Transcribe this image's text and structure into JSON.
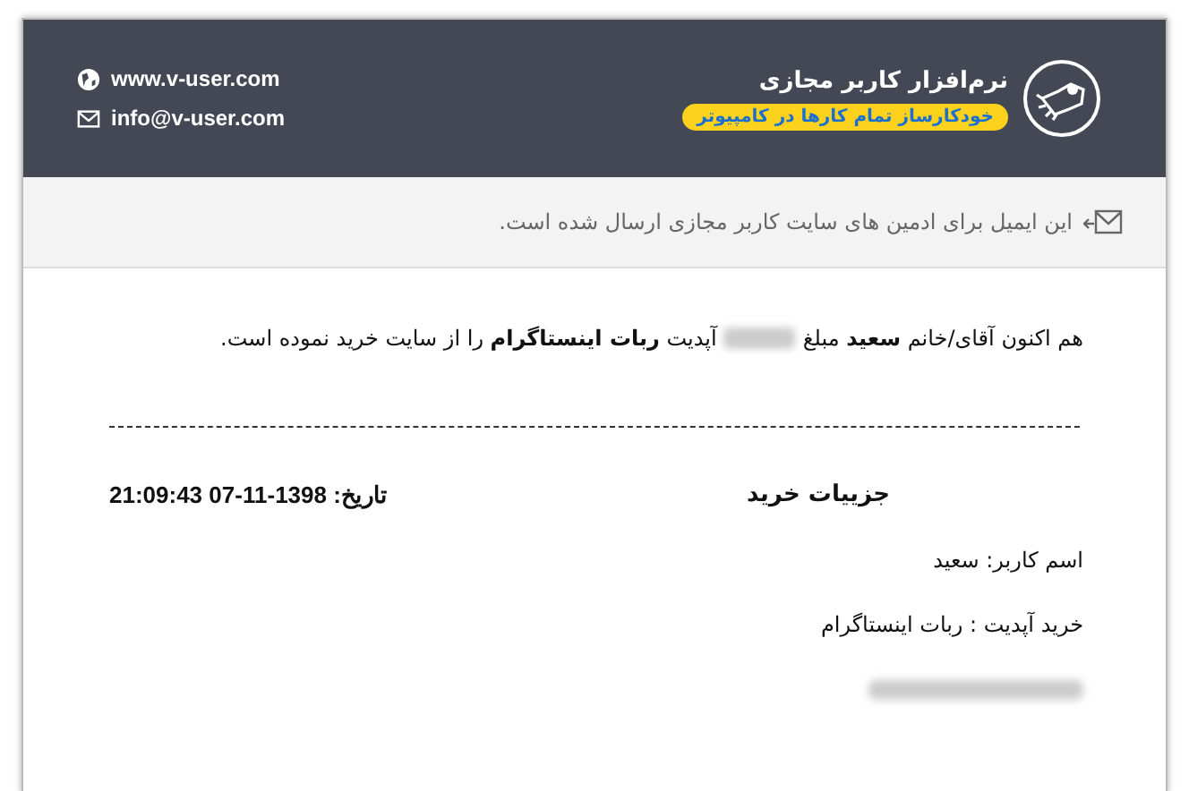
{
  "header": {
    "brand_title": "نرم‌افزار کاربر مجازی",
    "brand_tagline": "خودکارساز تمام کارها در کامپیوتر",
    "contacts": [
      {
        "kind": "web",
        "text": "www.v-user.com"
      },
      {
        "kind": "mail",
        "text": "info@v-user.com"
      }
    ]
  },
  "notice": "این ایمیل برای ادمین های سایت کاربر مجازی ارسال شده است.",
  "message": {
    "before_amount": "هم اکنون آقای/خانم **سعید** مبلغ",
    "after_amount": "آپدیت **ربات اینستاگرام** را از سایت خرید نموده است."
  },
  "details": {
    "title": "جزییات خرید",
    "date": "تاریخ: 1398-11-07 21:09:43",
    "lines": [
      "اسم کاربر: سعید",
      "خرید آپدیت : ربات اینستاگرام"
    ]
  }
}
